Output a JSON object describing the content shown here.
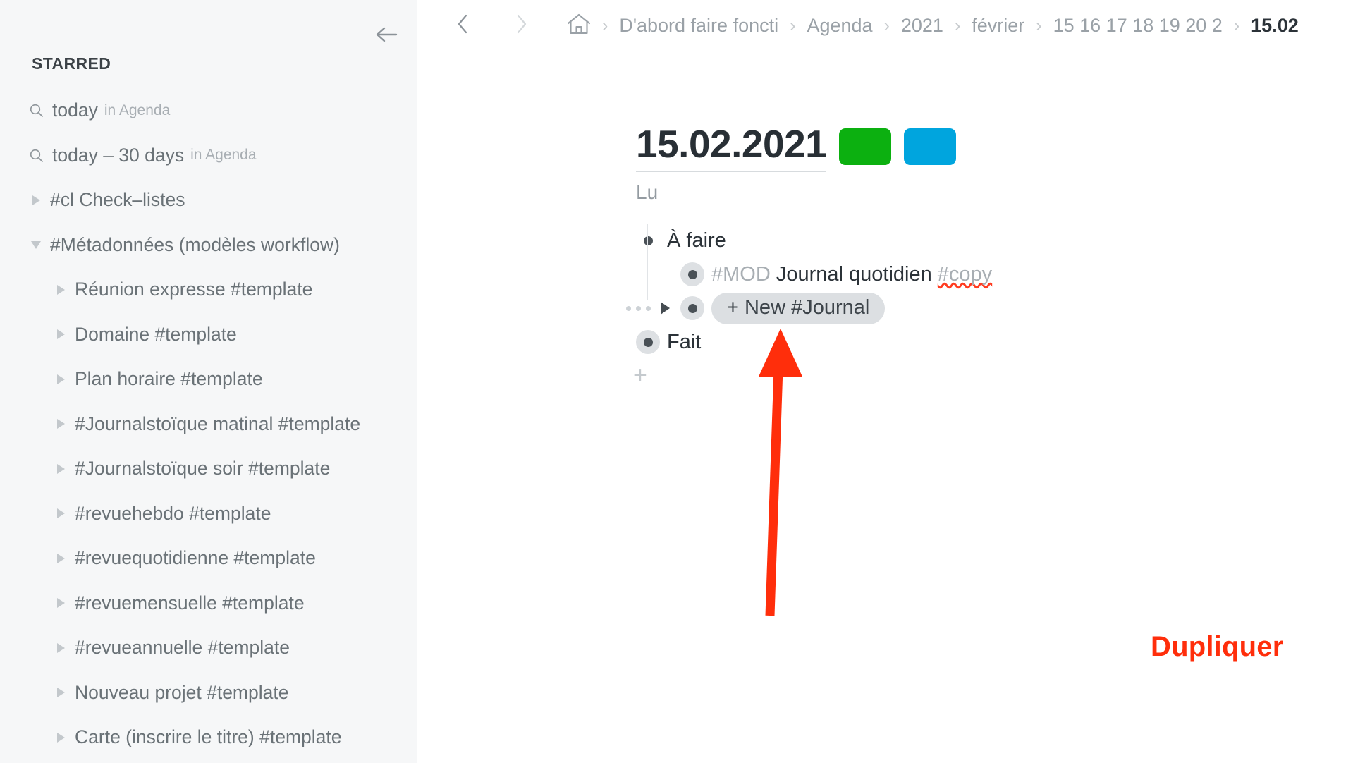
{
  "sidebar": {
    "collapse_icon": "arrow-left-icon",
    "header": "STARRED",
    "items": [
      {
        "level": 0,
        "icon": "search-icon",
        "label": "today",
        "sub": "in Agenda"
      },
      {
        "level": 0,
        "icon": "search-icon",
        "label": "today – 30 days",
        "sub": "in Agenda"
      },
      {
        "level": 0,
        "icon": "triangle-right-icon",
        "label": "#cl Check–listes",
        "sub": ""
      },
      {
        "level": 0,
        "icon": "triangle-down-icon",
        "label": "#Métadonnées (modèles workflow)",
        "sub": ""
      },
      {
        "level": 2,
        "icon": "triangle-right-icon",
        "label": "Réunion expresse #template",
        "sub": ""
      },
      {
        "level": 2,
        "icon": "triangle-right-icon",
        "label": "Domaine #template",
        "sub": ""
      },
      {
        "level": 2,
        "icon": "triangle-right-icon",
        "label": "Plan horaire #template",
        "sub": ""
      },
      {
        "level": 2,
        "icon": "triangle-right-icon",
        "label": "#Journalstoïque matinal #template",
        "sub": ""
      },
      {
        "level": 2,
        "icon": "triangle-right-icon",
        "label": "#Journalstoïque soir #template",
        "sub": ""
      },
      {
        "level": 2,
        "icon": "triangle-right-icon",
        "label": "#revuehebdo #template",
        "sub": ""
      },
      {
        "level": 2,
        "icon": "triangle-right-icon",
        "label": "#revuequotidienne #template",
        "sub": ""
      },
      {
        "level": 2,
        "icon": "triangle-right-icon",
        "label": "#revuemensuelle #template",
        "sub": ""
      },
      {
        "level": 2,
        "icon": "triangle-right-icon",
        "label": "#revueannuelle #template",
        "sub": ""
      },
      {
        "level": 2,
        "icon": "triangle-right-icon",
        "label": "Nouveau projet #template",
        "sub": ""
      },
      {
        "level": 2,
        "icon": "triangle-right-icon",
        "label": "Carte (inscrire le titre) #template",
        "sub": ""
      }
    ]
  },
  "toolbar": {
    "back_icon": "chevron-left-icon",
    "forward_icon": "chevron-right-icon",
    "home_icon": "home-icon",
    "separator": "›"
  },
  "breadcrumb": {
    "items": [
      {
        "label": "D'abord faire foncti",
        "current": false,
        "truncated": true
      },
      {
        "label": "Agenda",
        "current": false,
        "truncated": false
      },
      {
        "label": "2021",
        "current": false,
        "truncated": false
      },
      {
        "label": "février",
        "current": false,
        "truncated": false
      },
      {
        "label": "15 16 17 18 19 20 2",
        "current": false,
        "truncated": true
      },
      {
        "label": "15.02",
        "current": true,
        "truncated": true
      }
    ]
  },
  "document": {
    "title": "15.02.2021",
    "subtitle": "Lu",
    "chips": [
      {
        "name": "green-color-chip",
        "color": "#0cb010"
      },
      {
        "name": "blue-color-chip",
        "color": "#00a5de"
      }
    ],
    "add_item_label": "+"
  },
  "outline": {
    "rows": [
      {
        "level": 1,
        "bullet_halo": false,
        "kind": "text",
        "segments": [
          {
            "text": "À faire",
            "style": "normal"
          }
        ]
      },
      {
        "level": 2,
        "bullet_halo": true,
        "kind": "text",
        "segments": [
          {
            "text": "#MOD ",
            "style": "tag"
          },
          {
            "text": "Journal quotidien ",
            "style": "normal"
          },
          {
            "text": "#copy",
            "style": "misspell"
          }
        ]
      },
      {
        "level": 2,
        "bullet_halo": true,
        "kind": "pill",
        "has_drag_handle": true,
        "has_collapse_triangle": true,
        "pill_label": "+ New #Journal"
      },
      {
        "level": 1,
        "bullet_halo": true,
        "kind": "text",
        "segments": [
          {
            "text": "Fait",
            "style": "normal"
          }
        ]
      }
    ]
  },
  "annotation": {
    "label": "Dupliquer",
    "color": "#ff2e0b",
    "arrow_icon": "arrow-up-icon"
  }
}
